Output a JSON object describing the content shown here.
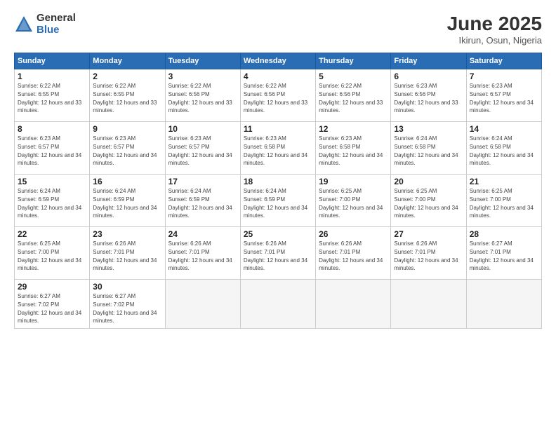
{
  "header": {
    "logo_general": "General",
    "logo_blue": "Blue",
    "title": "June 2025",
    "subtitle": "Ikirun, Osun, Nigeria"
  },
  "columns": [
    "Sunday",
    "Monday",
    "Tuesday",
    "Wednesday",
    "Thursday",
    "Friday",
    "Saturday"
  ],
  "weeks": [
    [
      {
        "day": "1",
        "sunrise": "6:22 AM",
        "sunset": "6:55 PM",
        "daylight": "12 hours and 33 minutes."
      },
      {
        "day": "2",
        "sunrise": "6:22 AM",
        "sunset": "6:55 PM",
        "daylight": "12 hours and 33 minutes."
      },
      {
        "day": "3",
        "sunrise": "6:22 AM",
        "sunset": "6:56 PM",
        "daylight": "12 hours and 33 minutes."
      },
      {
        "day": "4",
        "sunrise": "6:22 AM",
        "sunset": "6:56 PM",
        "daylight": "12 hours and 33 minutes."
      },
      {
        "day": "5",
        "sunrise": "6:22 AM",
        "sunset": "6:56 PM",
        "daylight": "12 hours and 33 minutes."
      },
      {
        "day": "6",
        "sunrise": "6:23 AM",
        "sunset": "6:56 PM",
        "daylight": "12 hours and 33 minutes."
      },
      {
        "day": "7",
        "sunrise": "6:23 AM",
        "sunset": "6:57 PM",
        "daylight": "12 hours and 34 minutes."
      }
    ],
    [
      {
        "day": "8",
        "sunrise": "6:23 AM",
        "sunset": "6:57 PM",
        "daylight": "12 hours and 34 minutes."
      },
      {
        "day": "9",
        "sunrise": "6:23 AM",
        "sunset": "6:57 PM",
        "daylight": "12 hours and 34 minutes."
      },
      {
        "day": "10",
        "sunrise": "6:23 AM",
        "sunset": "6:57 PM",
        "daylight": "12 hours and 34 minutes."
      },
      {
        "day": "11",
        "sunrise": "6:23 AM",
        "sunset": "6:58 PM",
        "daylight": "12 hours and 34 minutes."
      },
      {
        "day": "12",
        "sunrise": "6:23 AM",
        "sunset": "6:58 PM",
        "daylight": "12 hours and 34 minutes."
      },
      {
        "day": "13",
        "sunrise": "6:24 AM",
        "sunset": "6:58 PM",
        "daylight": "12 hours and 34 minutes."
      },
      {
        "day": "14",
        "sunrise": "6:24 AM",
        "sunset": "6:58 PM",
        "daylight": "12 hours and 34 minutes."
      }
    ],
    [
      {
        "day": "15",
        "sunrise": "6:24 AM",
        "sunset": "6:59 PM",
        "daylight": "12 hours and 34 minutes."
      },
      {
        "day": "16",
        "sunrise": "6:24 AM",
        "sunset": "6:59 PM",
        "daylight": "12 hours and 34 minutes."
      },
      {
        "day": "17",
        "sunrise": "6:24 AM",
        "sunset": "6:59 PM",
        "daylight": "12 hours and 34 minutes."
      },
      {
        "day": "18",
        "sunrise": "6:24 AM",
        "sunset": "6:59 PM",
        "daylight": "12 hours and 34 minutes."
      },
      {
        "day": "19",
        "sunrise": "6:25 AM",
        "sunset": "7:00 PM",
        "daylight": "12 hours and 34 minutes."
      },
      {
        "day": "20",
        "sunrise": "6:25 AM",
        "sunset": "7:00 PM",
        "daylight": "12 hours and 34 minutes."
      },
      {
        "day": "21",
        "sunrise": "6:25 AM",
        "sunset": "7:00 PM",
        "daylight": "12 hours and 34 minutes."
      }
    ],
    [
      {
        "day": "22",
        "sunrise": "6:25 AM",
        "sunset": "7:00 PM",
        "daylight": "12 hours and 34 minutes."
      },
      {
        "day": "23",
        "sunrise": "6:26 AM",
        "sunset": "7:01 PM",
        "daylight": "12 hours and 34 minutes."
      },
      {
        "day": "24",
        "sunrise": "6:26 AM",
        "sunset": "7:01 PM",
        "daylight": "12 hours and 34 minutes."
      },
      {
        "day": "25",
        "sunrise": "6:26 AM",
        "sunset": "7:01 PM",
        "daylight": "12 hours and 34 minutes."
      },
      {
        "day": "26",
        "sunrise": "6:26 AM",
        "sunset": "7:01 PM",
        "daylight": "12 hours and 34 minutes."
      },
      {
        "day": "27",
        "sunrise": "6:26 AM",
        "sunset": "7:01 PM",
        "daylight": "12 hours and 34 minutes."
      },
      {
        "day": "28",
        "sunrise": "6:27 AM",
        "sunset": "7:01 PM",
        "daylight": "12 hours and 34 minutes."
      }
    ],
    [
      {
        "day": "29",
        "sunrise": "6:27 AM",
        "sunset": "7:02 PM",
        "daylight": "12 hours and 34 minutes."
      },
      {
        "day": "30",
        "sunrise": "6:27 AM",
        "sunset": "7:02 PM",
        "daylight": "12 hours and 34 minutes."
      },
      null,
      null,
      null,
      null,
      null
    ]
  ]
}
